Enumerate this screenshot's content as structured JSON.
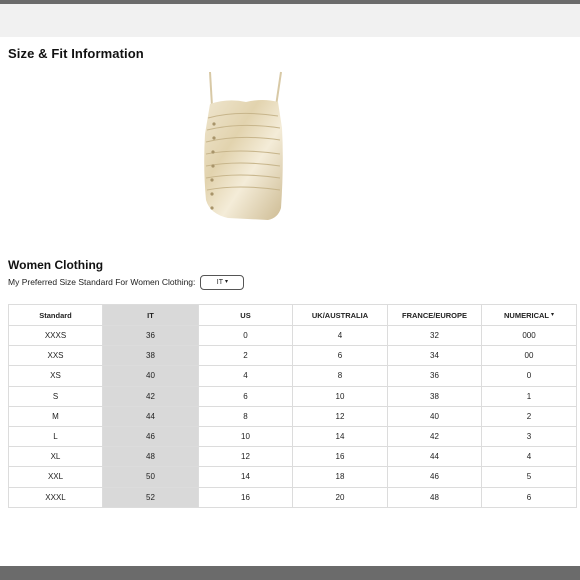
{
  "headings": {
    "size_fit": "Size & Fit Information",
    "women_clothing": "Women Clothing"
  },
  "preference": {
    "label": "My Preferred Size Standard For Women Clothing:",
    "selected": "IT"
  },
  "table": {
    "columns": [
      "Standard",
      "IT",
      "US",
      "UK/AUSTRALIA",
      "FRANCE/EUROPE",
      "NUMERICAL"
    ],
    "highlighted_column": "IT",
    "rows": [
      [
        "XXXS",
        "36",
        "0",
        "4",
        "32",
        "000"
      ],
      [
        "XXS",
        "38",
        "2",
        "6",
        "34",
        "00"
      ],
      [
        "XS",
        "40",
        "4",
        "8",
        "36",
        "0"
      ],
      [
        "S",
        "42",
        "6",
        "10",
        "38",
        "1"
      ],
      [
        "M",
        "44",
        "8",
        "12",
        "40",
        "2"
      ],
      [
        "L",
        "46",
        "10",
        "14",
        "42",
        "3"
      ],
      [
        "XL",
        "48",
        "12",
        "16",
        "44",
        "4"
      ],
      [
        "XXL",
        "50",
        "14",
        "18",
        "46",
        "5"
      ],
      [
        "XXXL",
        "52",
        "16",
        "20",
        "48",
        "6"
      ]
    ]
  },
  "icons": {
    "dropdown": "chevron-down-icon",
    "product": "product-image"
  },
  "colors": {
    "highlight": "#d9d9d9",
    "bars": "#6b6b6b",
    "strip": "#f1f1f1"
  }
}
